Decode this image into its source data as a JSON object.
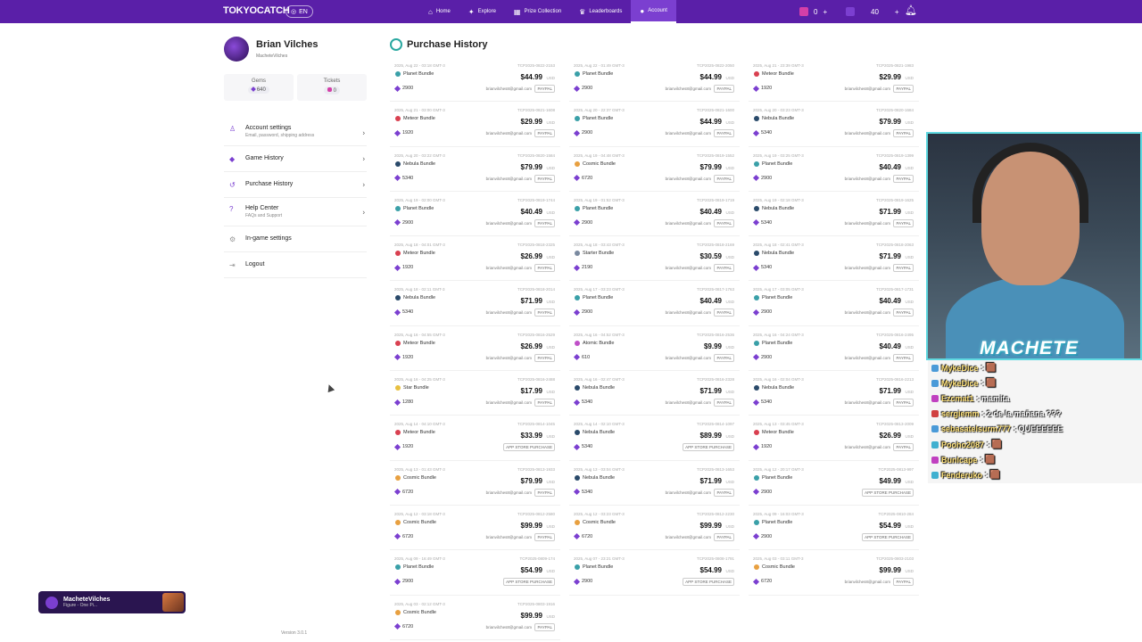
{
  "header": {
    "logo": "TOKYOCATCH",
    "lang": "EN",
    "nav": [
      {
        "label": "Home",
        "icon": "⌂"
      },
      {
        "label": "Explore",
        "icon": "✦"
      },
      {
        "label": "Prize Collection",
        "icon": "▦"
      },
      {
        "label": "Leaderboards",
        "icon": "♛"
      },
      {
        "label": "Account",
        "icon": "●"
      }
    ],
    "gems": "0",
    "tickets": "40",
    "plus": "+"
  },
  "profile": {
    "name": "Brian Vilches",
    "handle": "MacheteVilches",
    "gems_label": "Gems",
    "gems_value": "640",
    "tickets_label": "Tickets",
    "tickets_value": "0"
  },
  "menu": [
    {
      "label": "Account settings",
      "sub": "Email, password, shipping address",
      "icon": "♙",
      "chevron": "›"
    },
    {
      "label": "Game History",
      "sub": "",
      "icon": "◆",
      "chevron": "›"
    },
    {
      "label": "Purchase History",
      "sub": "",
      "icon": "↺",
      "chevron": "›"
    },
    {
      "label": "Help Center",
      "sub": "FAQs and Support",
      "icon": "?",
      "chevron": "›"
    },
    {
      "label": "In-game settings",
      "sub": "",
      "icon": "⚙",
      "chevron": ""
    },
    {
      "label": "Logout",
      "sub": "",
      "icon": "⇥",
      "chevron": ""
    }
  ],
  "version": "Version 3.0.1",
  "page_title": "Purchase History",
  "colors": {
    "brand": "#5a1fa8",
    "accent": "#7b3fd0",
    "history": "#2aa8a0"
  },
  "purchases": [
    {
      "date": "2025, Aug 22 - 03:18 GMT-3",
      "code": "TCP2025-0822-2153",
      "name": "Planet Bundle",
      "price": "$44.99",
      "gems": "2900",
      "email": "brianvilches8@gmail.com",
      "method": "PAYPAL",
      "color": "#3aa0a8"
    },
    {
      "date": "2025, Aug 22 - 01:49 GMT-3",
      "code": "TCP2025-0822-2050",
      "name": "Planet Bundle",
      "price": "$44.99",
      "gems": "2900",
      "email": "brianvilches8@gmail.com",
      "method": "PAYPAL",
      "color": "#3aa0a8"
    },
    {
      "date": "2025, Aug 21 - 23:39 GMT-3",
      "code": "TCP2025-0821-1983",
      "name": "Meteor Bundle",
      "price": "$29.99",
      "gems": "1920",
      "email": "brianvilches8@gmail.com",
      "method": "PAYPAL",
      "color": "#d94050"
    },
    {
      "date": "2025, Aug 21 - 03:00 GMT-3",
      "code": "TCP2025-0821-1608",
      "name": "Meteor Bundle",
      "price": "$29.99",
      "gems": "1920",
      "email": "brianvilches8@gmail.com",
      "method": "PAYPAL",
      "color": "#d94050"
    },
    {
      "date": "2025, Aug 20 - 22:37 GMT-3",
      "code": "TCP2025-0821-1600",
      "name": "Planet Bundle",
      "price": "$44.99",
      "gems": "2900",
      "email": "brianvilches8@gmail.com",
      "method": "PAYPAL",
      "color": "#3aa0a8"
    },
    {
      "date": "2025, Aug 20 - 03:23 GMT-3",
      "code": "TCP2025-0820-1684",
      "name": "Nebula Bundle",
      "price": "$79.99",
      "gems": "5340",
      "email": "brianvilches8@gmail.com",
      "method": "PAYPAL",
      "color": "#2a4a6a"
    },
    {
      "date": "2025, Aug 20 - 03:22 GMT-3",
      "code": "TCP2025-0820-1584",
      "name": "Nebula Bundle",
      "price": "$79.99",
      "gems": "5340",
      "email": "brianvilches8@gmail.com",
      "method": "PAYPAL",
      "color": "#2a4a6a"
    },
    {
      "date": "2025, Aug 19 - 04:48 GMT-3",
      "code": "TCP2025-0819-1552",
      "name": "Cosmic Bundle",
      "price": "$79.99",
      "gems": "6720",
      "email": "brianvilches8@gmail.com",
      "method": "PAYPAL",
      "color": "#e8a040"
    },
    {
      "date": "2025, Aug 19 - 03:25 GMT-3",
      "code": "TCP2025-0819-1399",
      "name": "Planet Bundle",
      "price": "$40.49",
      "gems": "2900",
      "email": "brianvilches8@gmail.com",
      "method": "PAYPAL",
      "color": "#3aa0a8"
    },
    {
      "date": "2025, Aug 19 - 02:00 GMT-3",
      "code": "TCP2025-0819-1744",
      "name": "Planet Bundle",
      "price": "$40.49",
      "gems": "2900",
      "email": "brianvilches8@gmail.com",
      "method": "PAYPAL",
      "color": "#3aa0a8"
    },
    {
      "date": "2025, Aug 19 - 01:52 GMT-3",
      "code": "TCP2025-0819-1719",
      "name": "Planet Bundle",
      "price": "$40.49",
      "gems": "2900",
      "email": "brianvilches8@gmail.com",
      "method": "PAYPAL",
      "color": "#3aa0a8"
    },
    {
      "date": "2025, Aug 19 - 02:18 GMT-3",
      "code": "TCP2025-0819-1625",
      "name": "Nebula Bundle",
      "price": "$71.99",
      "gems": "5340",
      "email": "brianvilches8@gmail.com",
      "method": "PAYPAL",
      "color": "#2a4a6a"
    },
    {
      "date": "2025, Aug 18 - 04:01 GMT-3",
      "code": "TCP2025-0818-2325",
      "name": "Meteor Bundle",
      "price": "$26.99",
      "gems": "1920",
      "email": "brianvilches8@gmail.com",
      "method": "PAYPAL",
      "color": "#d94050"
    },
    {
      "date": "2025, Aug 18 - 03:43 GMT-3",
      "code": "TCP2025-0818-2169",
      "name": "Starter Bundle",
      "price": "$30.59",
      "gems": "2190",
      "email": "brianvilches8@gmail.com",
      "method": "PAYPAL",
      "color": "#7a8aa0"
    },
    {
      "date": "2025, Aug 18 - 02:41 GMT-3",
      "code": "TCP2025-0818-2063",
      "name": "Nebula Bundle",
      "price": "$71.99",
      "gems": "5340",
      "email": "brianvilches8@gmail.com",
      "method": "PAYPAL",
      "color": "#2a4a6a"
    },
    {
      "date": "2025, Aug 18 - 02:11 GMT-3",
      "code": "TCP2025-0818-2014",
      "name": "Nebula Bundle",
      "price": "$71.99",
      "gems": "5340",
      "email": "brianvilches8@gmail.com",
      "method": "PAYPAL",
      "color": "#2a4a6a"
    },
    {
      "date": "2025, Aug 17 - 03:23 GMT-3",
      "code": "TCP2025-0817-1763",
      "name": "Planet Bundle",
      "price": "$40.49",
      "gems": "2900",
      "email": "brianvilches8@gmail.com",
      "method": "PAYPAL",
      "color": "#3aa0a8"
    },
    {
      "date": "2025, Aug 17 - 03:05 GMT-3",
      "code": "TCP2025-0817-1731",
      "name": "Planet Bundle",
      "price": "$40.49",
      "gems": "2900",
      "email": "brianvilches8@gmail.com",
      "method": "PAYPAL",
      "color": "#3aa0a8"
    },
    {
      "date": "2025, Aug 16 - 04:55 GMT-3",
      "code": "TCP2025-0816-2529",
      "name": "Meteor Bundle",
      "price": "$26.99",
      "gems": "1920",
      "email": "brianvilches8@gmail.com",
      "method": "PAYPAL",
      "color": "#d94050"
    },
    {
      "date": "2025, Aug 16 - 04:52 GMT-3",
      "code": "TCP2025-0816-2536",
      "name": "Atomic Bundle",
      "price": "$9.99",
      "gems": "610",
      "email": "brianvilches8@gmail.com",
      "method": "PAYPAL",
      "color": "#c050c8"
    },
    {
      "date": "2025, Aug 16 - 04:24 GMT-3",
      "code": "TCP2025-0816-2495",
      "name": "Planet Bundle",
      "price": "$40.49",
      "gems": "2900",
      "email": "brianvilches8@gmail.com",
      "method": "PAYPAL",
      "color": "#3aa0a8"
    },
    {
      "date": "2025, Aug 16 - 04:25 GMT-3",
      "code": "TCP2025-0816-2488",
      "name": "Star Bundle",
      "price": "$17.99",
      "gems": "1280",
      "email": "brianvilches8@gmail.com",
      "method": "PAYPAL",
      "color": "#e8c040"
    },
    {
      "date": "2025, Aug 16 - 02:47 GMT-3",
      "code": "TCP2025-0816-2328",
      "name": "Nebula Bundle",
      "price": "$71.99",
      "gems": "5340",
      "email": "brianvilches8@gmail.com",
      "method": "PAYPAL",
      "color": "#2a4a6a"
    },
    {
      "date": "2025, Aug 16 - 02:04 GMT-3",
      "code": "TCP2025-0816-2213",
      "name": "Nebula Bundle",
      "price": "$71.99",
      "gems": "5340",
      "email": "brianvilches8@gmail.com",
      "method": "PAYPAL",
      "color": "#2a4a6a"
    },
    {
      "date": "2025, Aug 14 - 04:10 GMT-3",
      "code": "TCP2025-0814-1045",
      "name": "Meteor Bundle",
      "price": "$33.99",
      "gems": "1920",
      "email": "",
      "method": "APP STORE PURCHASE",
      "color": "#d94050"
    },
    {
      "date": "2025, Aug 14 - 02:10 GMT-3",
      "code": "TCP2025-0814-1097",
      "name": "Nebula Bundle",
      "price": "$89.99",
      "gems": "5340",
      "email": "",
      "method": "APP STORE PURCHASE",
      "color": "#2a4a6a"
    },
    {
      "date": "2025, Aug 13 - 03:45 GMT-3",
      "code": "TCP2025-0813-2009",
      "name": "Meteor Bundle",
      "price": "$26.99",
      "gems": "1920",
      "email": "brianvilches8@gmail.com",
      "method": "PAYPAL",
      "color": "#d94050"
    },
    {
      "date": "2025, Aug 13 - 01:43 GMT-3",
      "code": "TCP2025-0813-1933",
      "name": "Cosmic Bundle",
      "price": "$79.99",
      "gems": "6720",
      "email": "brianvilches8@gmail.com",
      "method": "PAYPAL",
      "color": "#e8a040"
    },
    {
      "date": "2025, Aug 13 - 03:04 GMT-3",
      "code": "TCP2025-0813-1653",
      "name": "Nebula Bundle",
      "price": "$71.99",
      "gems": "5340",
      "email": "brianvilches8@gmail.com",
      "method": "PAYPAL",
      "color": "#2a4a6a"
    },
    {
      "date": "2025, Aug 12 - 20:17 GMT-3",
      "code": "TCP2025-0813-997",
      "name": "Planet Bundle",
      "price": "$49.99",
      "gems": "2900",
      "email": "",
      "method": "APP STORE PURCHASE",
      "color": "#3aa0a8"
    },
    {
      "date": "2025, Aug 12 - 03:18 GMT-3",
      "code": "TCP2025-0812-2580",
      "name": "Cosmic Bundle",
      "price": "$99.99",
      "gems": "6720",
      "email": "brianvilches8@gmail.com",
      "method": "PAYPAL",
      "color": "#e8a040"
    },
    {
      "date": "2025, Aug 12 - 03:23 GMT-3",
      "code": "TCP2025-0812-2230",
      "name": "Cosmic Bundle",
      "price": "$99.99",
      "gems": "6720",
      "email": "brianvilches8@gmail.com",
      "method": "PAYPAL",
      "color": "#e8a040"
    },
    {
      "date": "2025, Aug 09 - 16:03 GMT-3",
      "code": "TCP2025-0810-284",
      "name": "Planet Bundle",
      "price": "$54.99",
      "gems": "2900",
      "email": "",
      "method": "APP STORE PURCHASE",
      "color": "#3aa0a8"
    },
    {
      "date": "2025, Aug 09 - 16:49 GMT-3",
      "code": "TCP2025-0809-174",
      "name": "Planet Bundle",
      "price": "$54.99",
      "gems": "2900",
      "email": "",
      "method": "APP STORE PURCHASE",
      "color": "#3aa0a8"
    },
    {
      "date": "2025, Aug 07 - 23:21 GMT-3",
      "code": "TCP2025-0808-1791",
      "name": "Planet Bundle",
      "price": "$54.99",
      "gems": "2900",
      "email": "",
      "method": "APP STORE PURCHASE",
      "color": "#3aa0a8"
    },
    {
      "date": "2025, Aug 03 - 03:11 GMT-3",
      "code": "TCP2025-0803-2103",
      "name": "Cosmic Bundle",
      "price": "$99.99",
      "gems": "6720",
      "email": "brianvilches8@gmail.com",
      "method": "PAYPAL",
      "color": "#e8a040"
    },
    {
      "date": "2025, Aug 03 - 02:12 GMT-3",
      "code": "TCP2025-0803-1916",
      "name": "Cosmic Bundle",
      "price": "$99.99",
      "gems": "6720",
      "email": "brianvilches8@gmail.com",
      "method": "PAYPAL",
      "color": "#e8a040"
    }
  ],
  "currency_label": "USD",
  "cam_label": "MACHETE",
  "chat": [
    {
      "user": "MykeDice",
      "msg": ": 🟫",
      "badge": "#4a9ad8"
    },
    {
      "user": "MykeDice",
      "msg": ": 🟫",
      "badge": "#4a9ad8"
    },
    {
      "user": "Ezcmat1",
      "msg": ": mamita",
      "badge": "#c040c0"
    },
    {
      "user": "sergiemm",
      "msg": ": 2 de la mañana ???",
      "badge": "#d04040"
    },
    {
      "user": "sebasatelsurm777",
      "msg": ": QUEEEEEE",
      "badge": "#4a9ad8"
    },
    {
      "user": "Pooho2087",
      "msg": ": 🟫",
      "badge": "#40b0d0"
    },
    {
      "user": "Bunlcape",
      "msg": ": 🟫",
      "badge": "#c040c0"
    },
    {
      "user": "Fenderuko",
      "msg": ": 🟫",
      "badge": "#40b0d0"
    }
  ],
  "toast": {
    "name": "MacheteVilches",
    "sub": "Figure - One Pi..."
  }
}
